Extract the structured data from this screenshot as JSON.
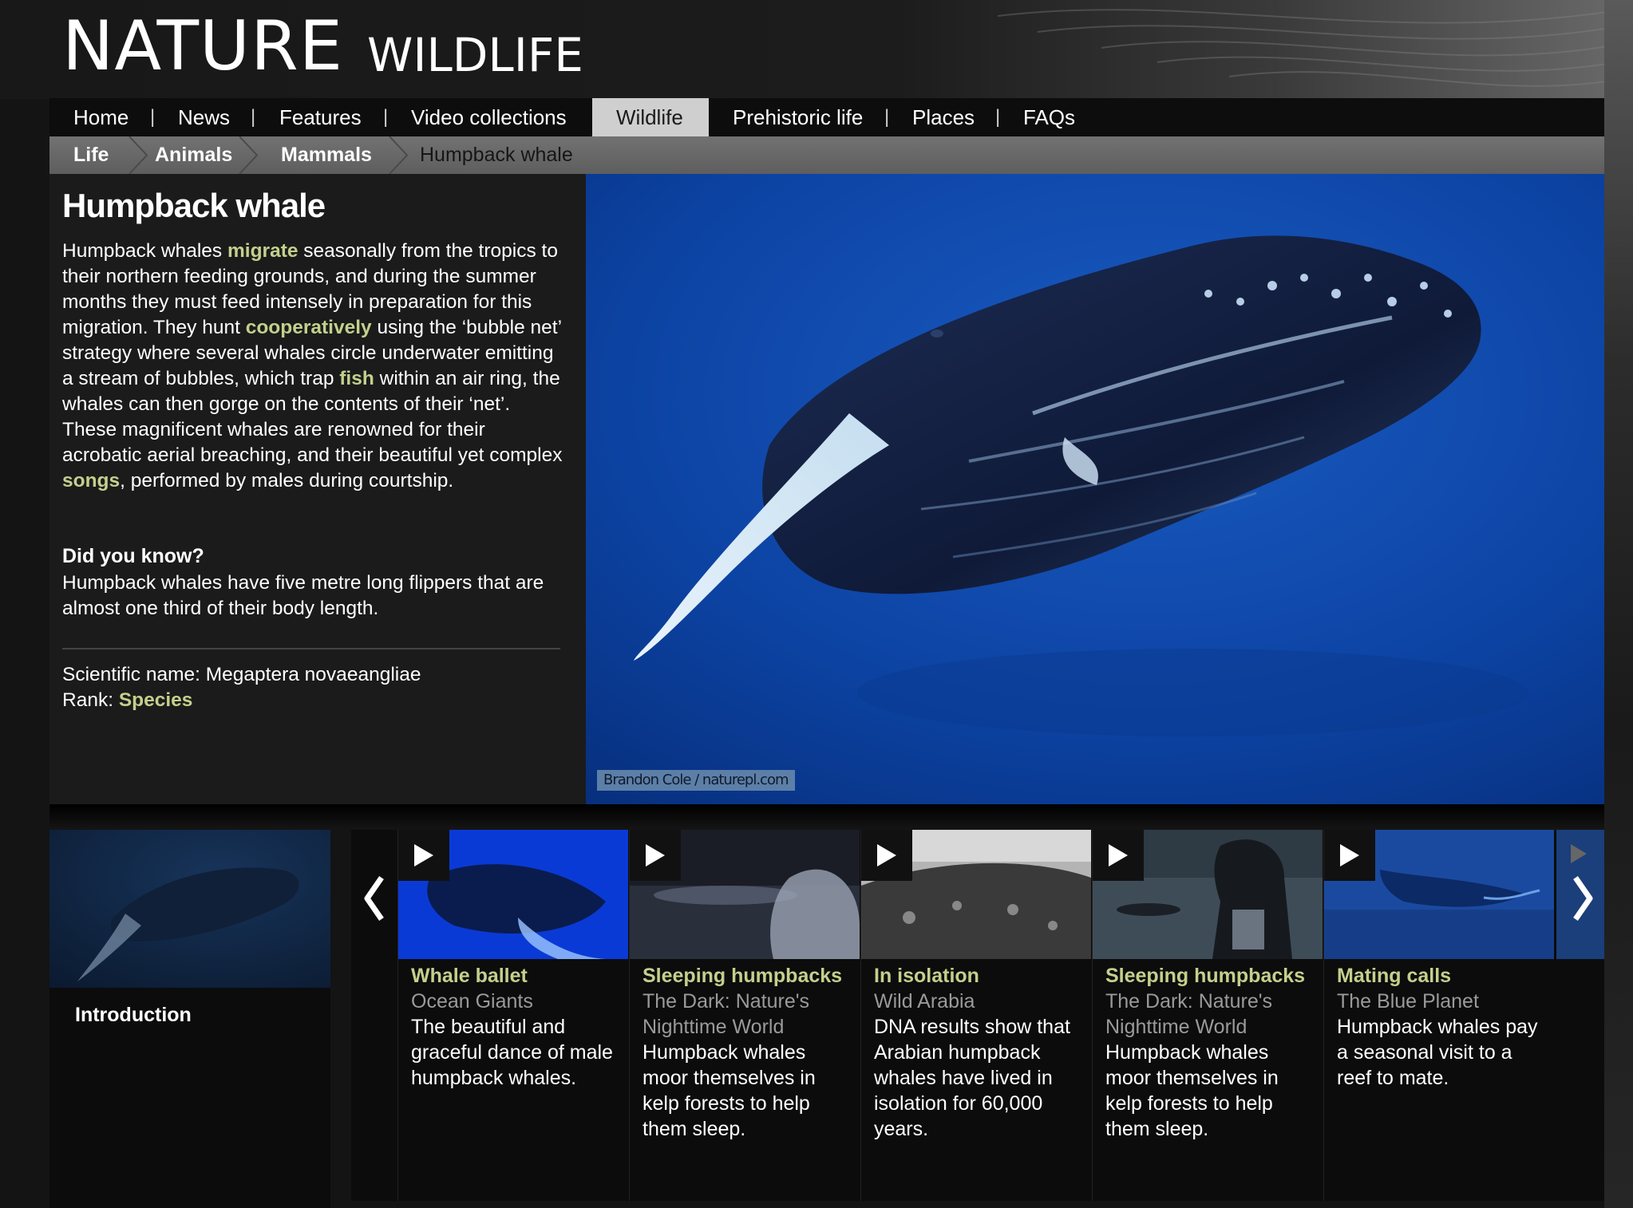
{
  "brand": {
    "nature": "NATURE",
    "wildlife": "WILDLIFE"
  },
  "nav": {
    "items": [
      "Home",
      "News",
      "Features",
      "Video collections",
      "Wildlife",
      "Prehistoric life",
      "Places",
      "FAQs"
    ],
    "active": "Wildlife"
  },
  "breadcrumb": {
    "items": [
      "Life",
      "Animals",
      "Mammals",
      "Humpback whale"
    ]
  },
  "article": {
    "title": "Humpback whale",
    "description_parts": [
      {
        "text": "Humpback whales ",
        "link": false
      },
      {
        "text": "migrate",
        "link": true
      },
      {
        "text": " seasonally from the tropics to their northern feeding grounds, and during the summer months they must feed intensely in preparation for this migration. They hunt ",
        "link": false
      },
      {
        "text": "cooperatively",
        "link": true
      },
      {
        "text": " using the ‘bubble net’ strategy where several whales circle underwater emitting a stream of bubbles, which trap ",
        "link": false
      },
      {
        "text": "fish",
        "link": true
      },
      {
        "text": " within an air ring, the whales can then gorge on the contents of their ‘net’. These magnificent whales are renowned for their acrobatic aerial breaching, and their beautiful yet complex ",
        "link": false
      },
      {
        "text": "songs",
        "link": true
      },
      {
        "text": ", performed by males during courtship.",
        "link": false
      }
    ],
    "did_you_know_heading": "Did you know?",
    "did_you_know_text": "Humpback whales have five metre long flippers that are almost one third of their body length.",
    "scientific_name_label": "Scientific name: ",
    "scientific_name": "Megaptera novaeangliae",
    "rank_label": "Rank: ",
    "rank": "Species"
  },
  "hero": {
    "credit": "Brandon Cole / naturepl.com"
  },
  "intro": {
    "label": "Introduction"
  },
  "videos": [
    {
      "title": "Whale ballet",
      "series": "Ocean Giants",
      "description": "The beautiful and graceful dance of male humpback whales."
    },
    {
      "title": "Sleeping humpbacks",
      "series": "The Dark: Nature's Nighttime World",
      "description": "Humpback whales moor themselves in kelp forests to help them sleep."
    },
    {
      "title": "In isolation",
      "series": "Wild Arabia",
      "description": "DNA results show that Arabian humpback whales have lived in isolation for 60,000 years."
    },
    {
      "title": "Sleeping humpbacks",
      "series": "The Dark: Nature's Nighttime World",
      "description": "Humpback whales moor themselves in kelp forests to help them sleep."
    },
    {
      "title": "Mating calls",
      "series": "The Blue Planet",
      "description": "Humpback whales pay a seasonal visit to a reef to mate."
    }
  ],
  "icons": {
    "play": "play-icon",
    "prev": "chevron-left-icon",
    "next": "chevron-right-icon"
  },
  "colors": {
    "link": "#c3d08c",
    "nav_active": "#cfcfcf",
    "hero_blue": "#0b3f9a"
  }
}
